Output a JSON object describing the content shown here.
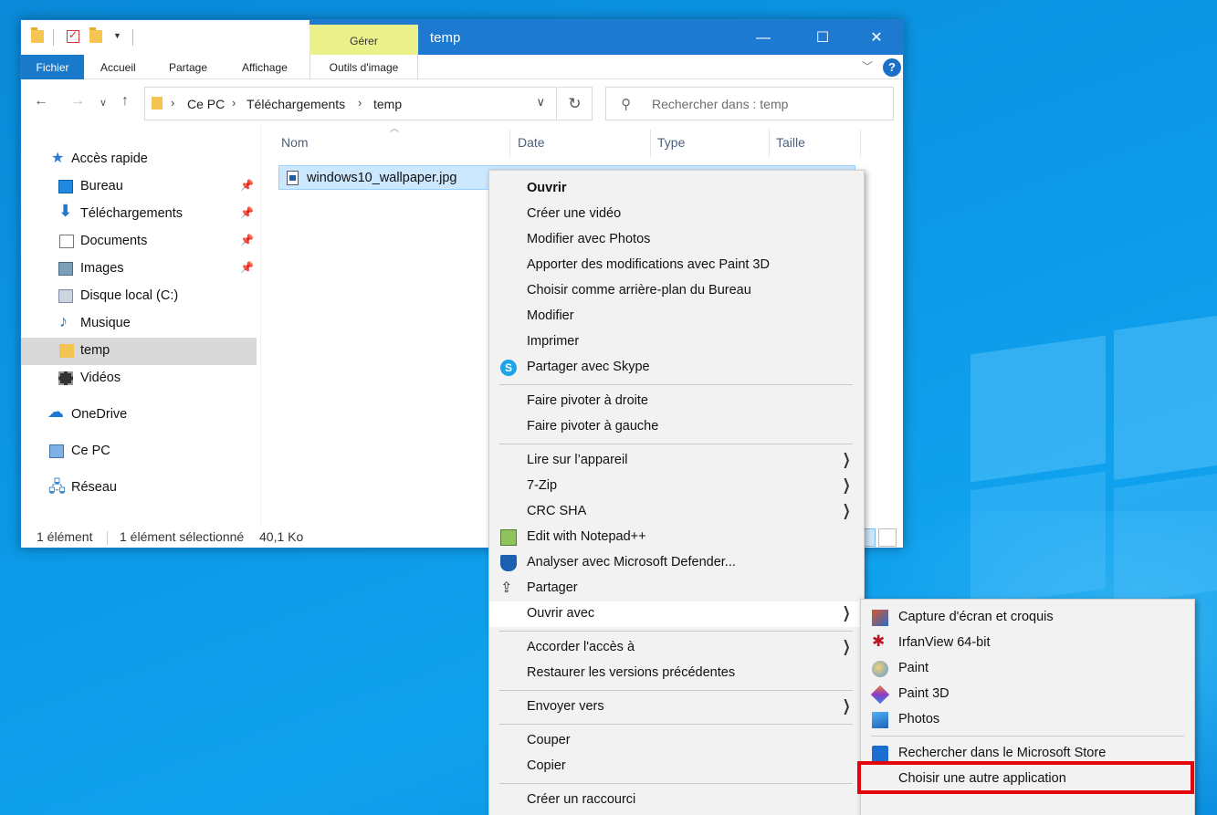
{
  "explorer": {
    "title": "temp",
    "contextual_tab": "Gérer",
    "contextual_sub": "Outils d'image",
    "ribbon_tabs": [
      "Fichier",
      "Accueil",
      "Partage",
      "Affichage"
    ],
    "window_controls": {
      "minimize": "—",
      "maximize": "☐",
      "close": "✕"
    },
    "help": "?",
    "address": {
      "crumbs": [
        "Ce PC",
        "Téléchargements",
        "temp"
      ]
    },
    "search_placeholder": "Rechercher dans : temp",
    "nav_pane": {
      "quick_access": "Accès rapide",
      "items": [
        {
          "label": "Bureau",
          "icon": "desktop-icon",
          "pinned": true
        },
        {
          "label": "Téléchargements",
          "icon": "download-icon",
          "pinned": true
        },
        {
          "label": "Documents",
          "icon": "documents-icon",
          "pinned": true
        },
        {
          "label": "Images",
          "icon": "pictures-icon",
          "pinned": true
        },
        {
          "label": "Disque local (C:)",
          "icon": "drive-icon",
          "pinned": false
        },
        {
          "label": "Musique",
          "icon": "music-icon",
          "pinned": false
        },
        {
          "label": "temp",
          "icon": "folder-icon",
          "pinned": false,
          "selected": true
        },
        {
          "label": "Vidéos",
          "icon": "video-icon",
          "pinned": false
        }
      ],
      "onedrive": "OneDrive",
      "this_pc": "Ce PC",
      "network": "Réseau"
    },
    "columns": [
      "Nom",
      "Date",
      "Type",
      "Taille"
    ],
    "files": [
      {
        "name": "windows10_wallpaper.jpg",
        "selected": true
      }
    ],
    "status": {
      "count": "1 élément",
      "selection": "1 élément sélectionné",
      "size": "40,1 Ko"
    }
  },
  "context_menu": {
    "items": [
      {
        "label": "Ouvrir",
        "bold": true
      },
      {
        "label": "Créer une vidéo"
      },
      {
        "label": "Modifier avec Photos"
      },
      {
        "label": "Apporter des modifications avec Paint 3D"
      },
      {
        "label": "Choisir comme arrière-plan du Bureau"
      },
      {
        "label": "Modifier"
      },
      {
        "label": "Imprimer"
      },
      {
        "label": "Partager avec Skype",
        "icon": "skype-icon"
      },
      {
        "label": "Faire pivoter à droite"
      },
      {
        "label": "Faire pivoter à gauche"
      },
      {
        "label": "Lire sur l’appareil",
        "submenu": true
      },
      {
        "label": "7-Zip",
        "submenu": true
      },
      {
        "label": "CRC SHA",
        "submenu": true
      },
      {
        "label": "Edit with Notepad++",
        "icon": "notepadpp-icon"
      },
      {
        "label": "Analyser avec Microsoft Defender...",
        "icon": "defender-icon"
      },
      {
        "label": "Partager",
        "icon": "share-icon"
      },
      {
        "label": "Ouvrir avec",
        "submenu": true,
        "highlighted": true
      },
      {
        "label": "Accorder l'accès à",
        "submenu": true
      },
      {
        "label": "Restaurer les versions précédentes"
      },
      {
        "label": "Envoyer vers",
        "submenu": true
      },
      {
        "label": "Couper"
      },
      {
        "label": "Copier"
      },
      {
        "label": "Créer un raccourci"
      }
    ]
  },
  "open_with_submenu": {
    "items": [
      {
        "label": "Capture d'écran et croquis",
        "icon": "snip-sketch-icon"
      },
      {
        "label": "IrfanView 64-bit",
        "icon": "irfanview-icon"
      },
      {
        "label": "Paint",
        "icon": "paint-icon"
      },
      {
        "label": "Paint 3D",
        "icon": "paint3d-icon"
      },
      {
        "label": "Photos",
        "icon": "photos-icon"
      },
      {
        "label": "Rechercher dans le Microsoft Store",
        "icon": "store-icon"
      },
      {
        "label": "Choisir une autre application",
        "highlighted_box": true
      }
    ],
    "highlight_color": "#e3060c"
  }
}
